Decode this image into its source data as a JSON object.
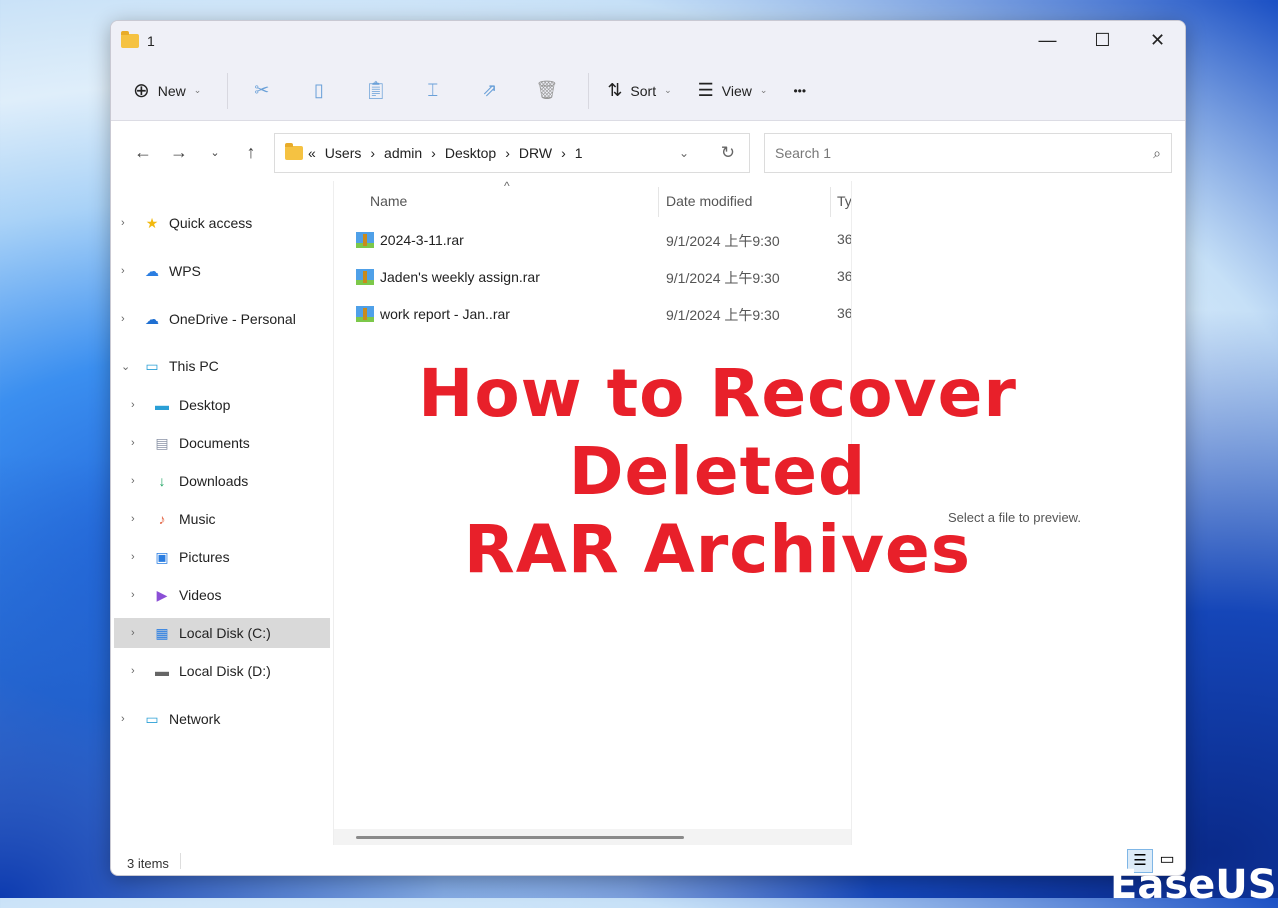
{
  "window": {
    "title": "1",
    "controls": [
      "—",
      "☐",
      "✕"
    ]
  },
  "toolbar": {
    "new": "New",
    "sort": "Sort",
    "view": "View",
    "more": "•••"
  },
  "address": {
    "crumbs": [
      "«",
      "Users",
      "›",
      "admin",
      "›",
      "Desktop",
      "›",
      "DRW",
      "›",
      "1"
    ],
    "search_placeholder": "Search 1"
  },
  "sidebar": [
    {
      "label": "Quick access",
      "icon": "★",
      "color": "#f2b90f"
    },
    {
      "label": "WPS",
      "icon": "☁",
      "color": "#2a7de1"
    },
    {
      "label": "OneDrive - Personal",
      "icon": "☁",
      "color": "#1f6fd1"
    },
    {
      "label": "This PC",
      "icon": "▭",
      "color": "#2a9fd6"
    },
    {
      "label": "Desktop",
      "icon": "▬",
      "color": "#2a9fd6"
    },
    {
      "label": "Documents",
      "icon": "▤",
      "color": "#8a93a6"
    },
    {
      "label": "Downloads",
      "icon": "↓",
      "color": "#1aa260"
    },
    {
      "label": "Music",
      "icon": "♪",
      "color": "#e46a4a"
    },
    {
      "label": "Pictures",
      "icon": "▣",
      "color": "#2a7de1"
    },
    {
      "label": "Videos",
      "icon": "▶",
      "color": "#8b4fd6"
    },
    {
      "label": "Local Disk (C:)",
      "icon": "▦",
      "color": "#2a7de1"
    },
    {
      "label": "Local Disk (D:)",
      "icon": "▬",
      "color": "#666"
    },
    {
      "label": "Network",
      "icon": "▭",
      "color": "#2a9fd6"
    }
  ],
  "columns": {
    "name": "Name",
    "date": "Date modified",
    "type": "Ty"
  },
  "files": [
    {
      "name": "2024-3-11.rar",
      "date": "9/1/2024 上午9:30",
      "type": "36"
    },
    {
      "name": "Jaden's weekly assign.rar",
      "date": "9/1/2024 上午9:30",
      "type": "36"
    },
    {
      "name": "work report - Jan..rar",
      "date": "9/1/2024 上午9:30",
      "type": "36"
    }
  ],
  "preview_text": "Select a file to preview.",
  "status": "3 items",
  "overlay": {
    "line1": "How to Recover Deleted",
    "line2": "RAR Archives"
  },
  "brand": "EaseUS®"
}
